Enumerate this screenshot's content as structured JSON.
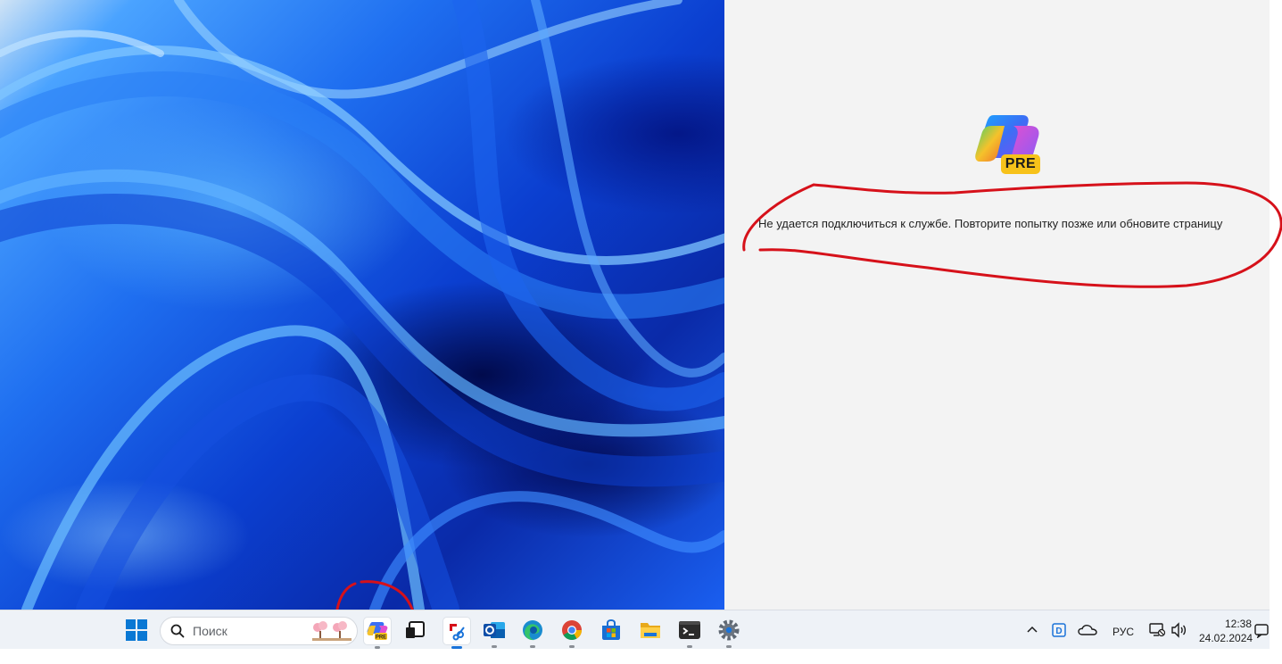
{
  "copilot": {
    "badge": "PRE",
    "error_message": "Не удается подключиться к службе. Повторите попытку позже или обновите страницу"
  },
  "taskbar": {
    "search_placeholder": "Поиск",
    "pinned_apps": [
      {
        "name": "start",
        "icon": "windows-start-icon"
      },
      {
        "name": "copilot-preview",
        "icon": "copilot-pre-icon"
      },
      {
        "name": "task-view",
        "icon": "task-view-icon"
      },
      {
        "name": "snipping-tool",
        "icon": "snipping-tool-icon"
      },
      {
        "name": "outlook",
        "icon": "outlook-icon"
      },
      {
        "name": "edge",
        "icon": "edge-icon"
      },
      {
        "name": "chrome",
        "icon": "chrome-icon"
      },
      {
        "name": "microsoft-store",
        "icon": "store-icon"
      },
      {
        "name": "file-explorer",
        "icon": "folder-icon"
      },
      {
        "name": "terminal",
        "icon": "terminal-icon"
      },
      {
        "name": "settings",
        "icon": "gear-icon"
      }
    ]
  },
  "tray": {
    "language": "РУС",
    "time": "12:38",
    "date": "24.02.2024"
  },
  "colors": {
    "annotation": "#d6111a",
    "panel_bg": "#f3f3f3",
    "taskbar_bg": "#eef2f7",
    "badge": "#f7c21a"
  }
}
